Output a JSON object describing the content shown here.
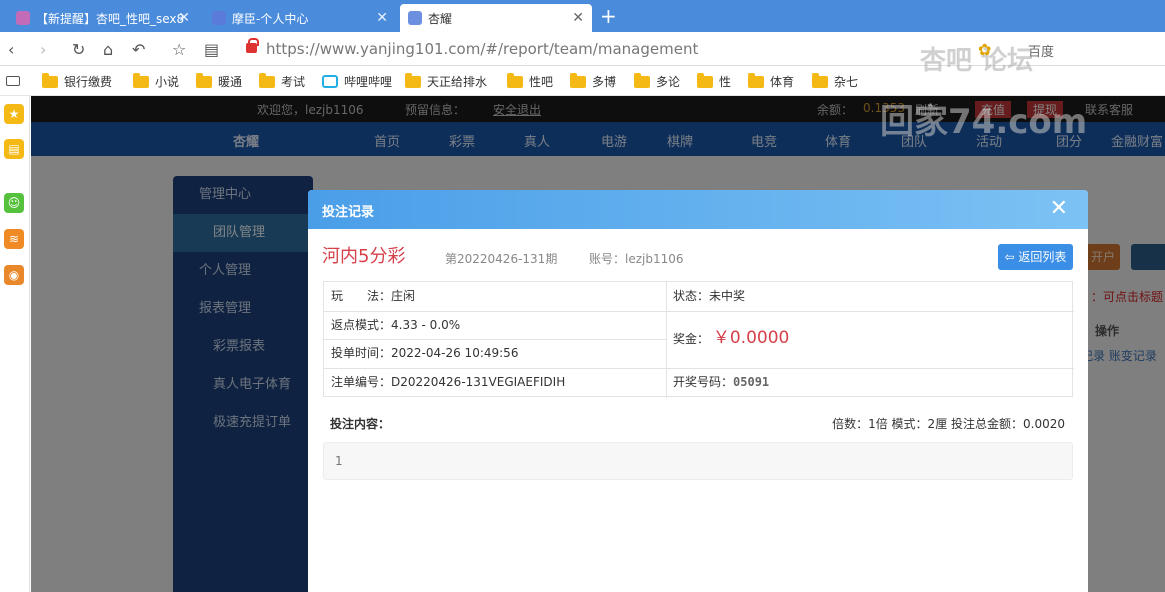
{
  "browser": {
    "tabs": [
      {
        "title": "【新提醒】杏吧_性吧_sex8"
      },
      {
        "title": "摩臣-个人中心"
      },
      {
        "title": "杏耀"
      }
    ],
    "new_tab": "+",
    "url": "https://www.yanjing101.com/#/report/team/management",
    "search_engine": "百度",
    "bookmarks": [
      "银行缴费",
      "小说",
      "暖通",
      "考试",
      "哔哩哔哩",
      "天正给排水",
      "性吧",
      "多博",
      "多论",
      "性",
      "体育",
      "杂七"
    ]
  },
  "watermark": {
    "line1": "杏吧  论坛",
    "line2": "回家74.com"
  },
  "site": {
    "welcome": "欢迎您，lezjb1106",
    "reserve_info": "预留信息：",
    "logout": "安全退出",
    "balance_label": "余额：",
    "balance_value": "0.1353",
    "refresh": "刷新",
    "recharge": "充值",
    "withdraw": "提现",
    "support": "联系客服",
    "logo": "杏耀",
    "nav": [
      "首页",
      "彩票",
      "真人",
      "电游",
      "棋牌",
      "电竞",
      "体育",
      "团队",
      "活动",
      "团分",
      "金融财富"
    ],
    "menu": {
      "manage_center": "管理中心",
      "team_manage": "团队管理",
      "personal_manage": "个人管理",
      "report_manage": "报表管理",
      "lottery_report": "彩票报表",
      "live_sports": "真人电子体育",
      "fast_order": "极速充提订单"
    },
    "behind": {
      "open_account": "开户",
      "hint": "：可点击标题",
      "op_header": "操作",
      "links": "记录  账变记录"
    }
  },
  "modal": {
    "title": "投注记录",
    "close": "✕",
    "game_name": "河内5分彩",
    "issue": "第20220426-131期",
    "account": "账号：lezjb1106",
    "back_button": "返回列表",
    "play_label": "玩　　法：",
    "play_value": "庄闲",
    "status": "状态：未中奖",
    "rebate": "返点模式：4.33 - 0.0%",
    "prize_label": "奖金：",
    "prize_value": "￥0.0000",
    "bet_time": "投单时间：2022-04-26 10:49:56",
    "order_no": "注单编号：D20220426-131VEGIAEFIDIH",
    "draw_label": "开奖号码：",
    "draw_value": "05091",
    "content_label": "投注内容：",
    "summary": "倍数：1倍   模式：2厘   投注总金额：0.0020",
    "content_value": "1"
  }
}
